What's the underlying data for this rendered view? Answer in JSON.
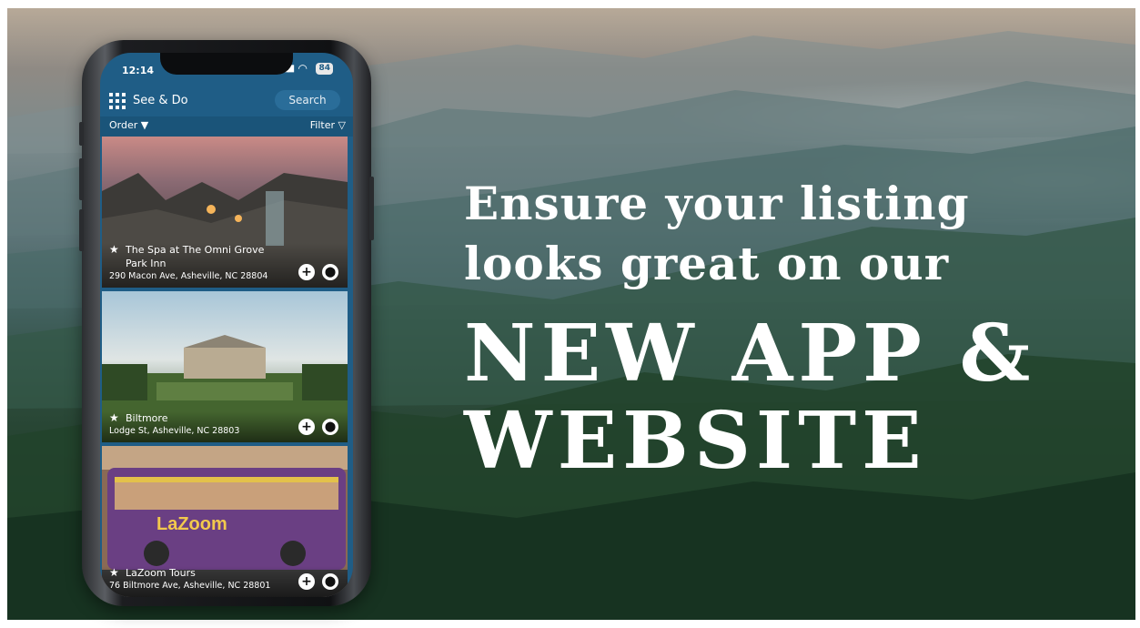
{
  "headline": {
    "line1": "Ensure your listing",
    "line2": "looks great on our",
    "line3": "NEW APP &",
    "line4": "WEBSITE"
  },
  "phone": {
    "status": {
      "time": "12:14",
      "battery": "84"
    },
    "app_bar": {
      "title": "See & Do",
      "search_label": "Search"
    },
    "filter_bar": {
      "order_label": "Order ▼",
      "filter_label": "Filter"
    },
    "listings": [
      {
        "name_line1": "The Spa at The Omni Grove",
        "name_line2": "Park Inn",
        "address": "290 Macon Ave, Asheville, NC 28804"
      },
      {
        "name_line1": "Biltmore",
        "name_line2": "",
        "address": "Lodge St, Asheville, NC 28803"
      },
      {
        "name_line1": "LaZoom Tours",
        "name_line2": "",
        "address": "76 Biltmore Ave, Asheville, NC 28801",
        "bus_sign": "LaZoom"
      }
    ]
  },
  "colors": {
    "app_blue": "#1f5d86",
    "filter_bar": "#1a5479"
  }
}
